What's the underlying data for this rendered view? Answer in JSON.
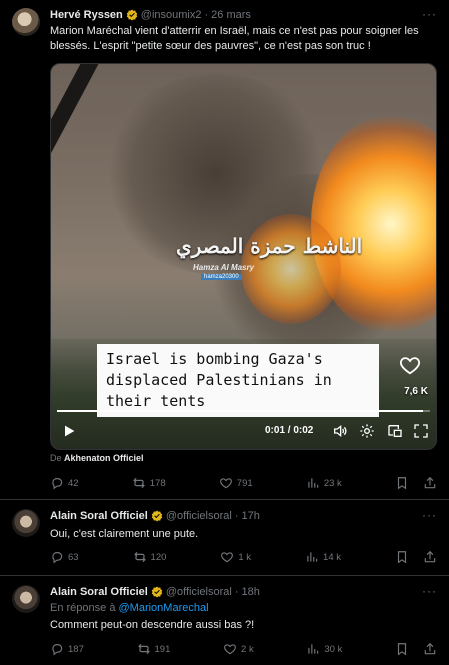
{
  "tweets": [
    {
      "author": "Hervé Ryssen",
      "handle": "@insoumix2",
      "time": "26 mars",
      "text": "Marion Maréchal vient d'atterrir en Israël, mais ce n'est pas pour soigner les blessés. L'esprit \"petite sœur des pauvres\", ce n'est pas son truc !",
      "media": {
        "watermark_arabic": "الناشط حمزة المصري",
        "watermark_name": "Hamza Al Masry",
        "watermark_tag": "hamza20300",
        "caption": "Israel is bombing Gaza's displaced Palestinians in their tents",
        "like_count": "7,6 K",
        "video_time": "0:01 / 0:02",
        "progress_percent": 98
      },
      "source_prefix": "De",
      "source_name": "Akhenaton Officiel",
      "stats": {
        "replies": "42",
        "retweets": "178",
        "likes": "791",
        "views": "23 k"
      }
    },
    {
      "author": "Alain Soral Officiel",
      "handle": "@officielsoral",
      "time": "17h",
      "text": "Oui, c'est clairement une pute.",
      "stats": {
        "replies": "63",
        "retweets": "120",
        "likes": "1 k",
        "views": "14 k"
      }
    },
    {
      "author": "Alain Soral Officiel",
      "handle": "@officielsoral",
      "time": "18h",
      "reply_prefix": "En réponse à",
      "reply_mention": "@MarionMarechal",
      "text": "Comment peut-on descendre aussi bas ?!",
      "stats": {
        "replies": "187",
        "retweets": "191",
        "likes": "2 k",
        "views": "30 k"
      }
    }
  ],
  "more_label": "···",
  "colors": {
    "background": "#000000",
    "text": "#e7e9ea",
    "muted": "#71767b",
    "accent": "#1d9bf0",
    "verified": "#e2b719"
  }
}
